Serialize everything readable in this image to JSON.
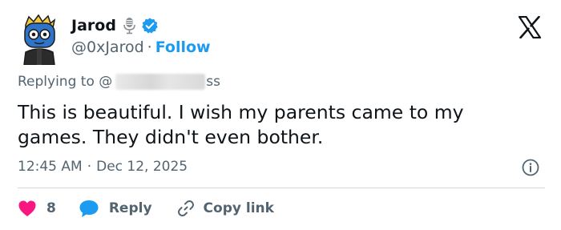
{
  "author": {
    "display_name": "Jarod",
    "handle": "@0xJarod",
    "separator": "·",
    "follow_label": "Follow",
    "avatar_icon": "blue-cartoon-avatar-icon",
    "verified_color": "#1d9bf0"
  },
  "reply": {
    "prefix": "Replying to @",
    "redacted_suffix": "ss"
  },
  "tweet": {
    "text": "This is beautiful. I wish my parents came to my games. They didn't even bother.",
    "time": "12:45 AM",
    "separator": "·",
    "date": "Dec 12, 2025"
  },
  "actions": {
    "like_count": "8",
    "reply_label": "Reply",
    "copy_link_label": "Copy link"
  },
  "colors": {
    "accent": "#1d9bf0",
    "like": "#f91880",
    "text": "#0f1419",
    "muted": "#536471"
  }
}
